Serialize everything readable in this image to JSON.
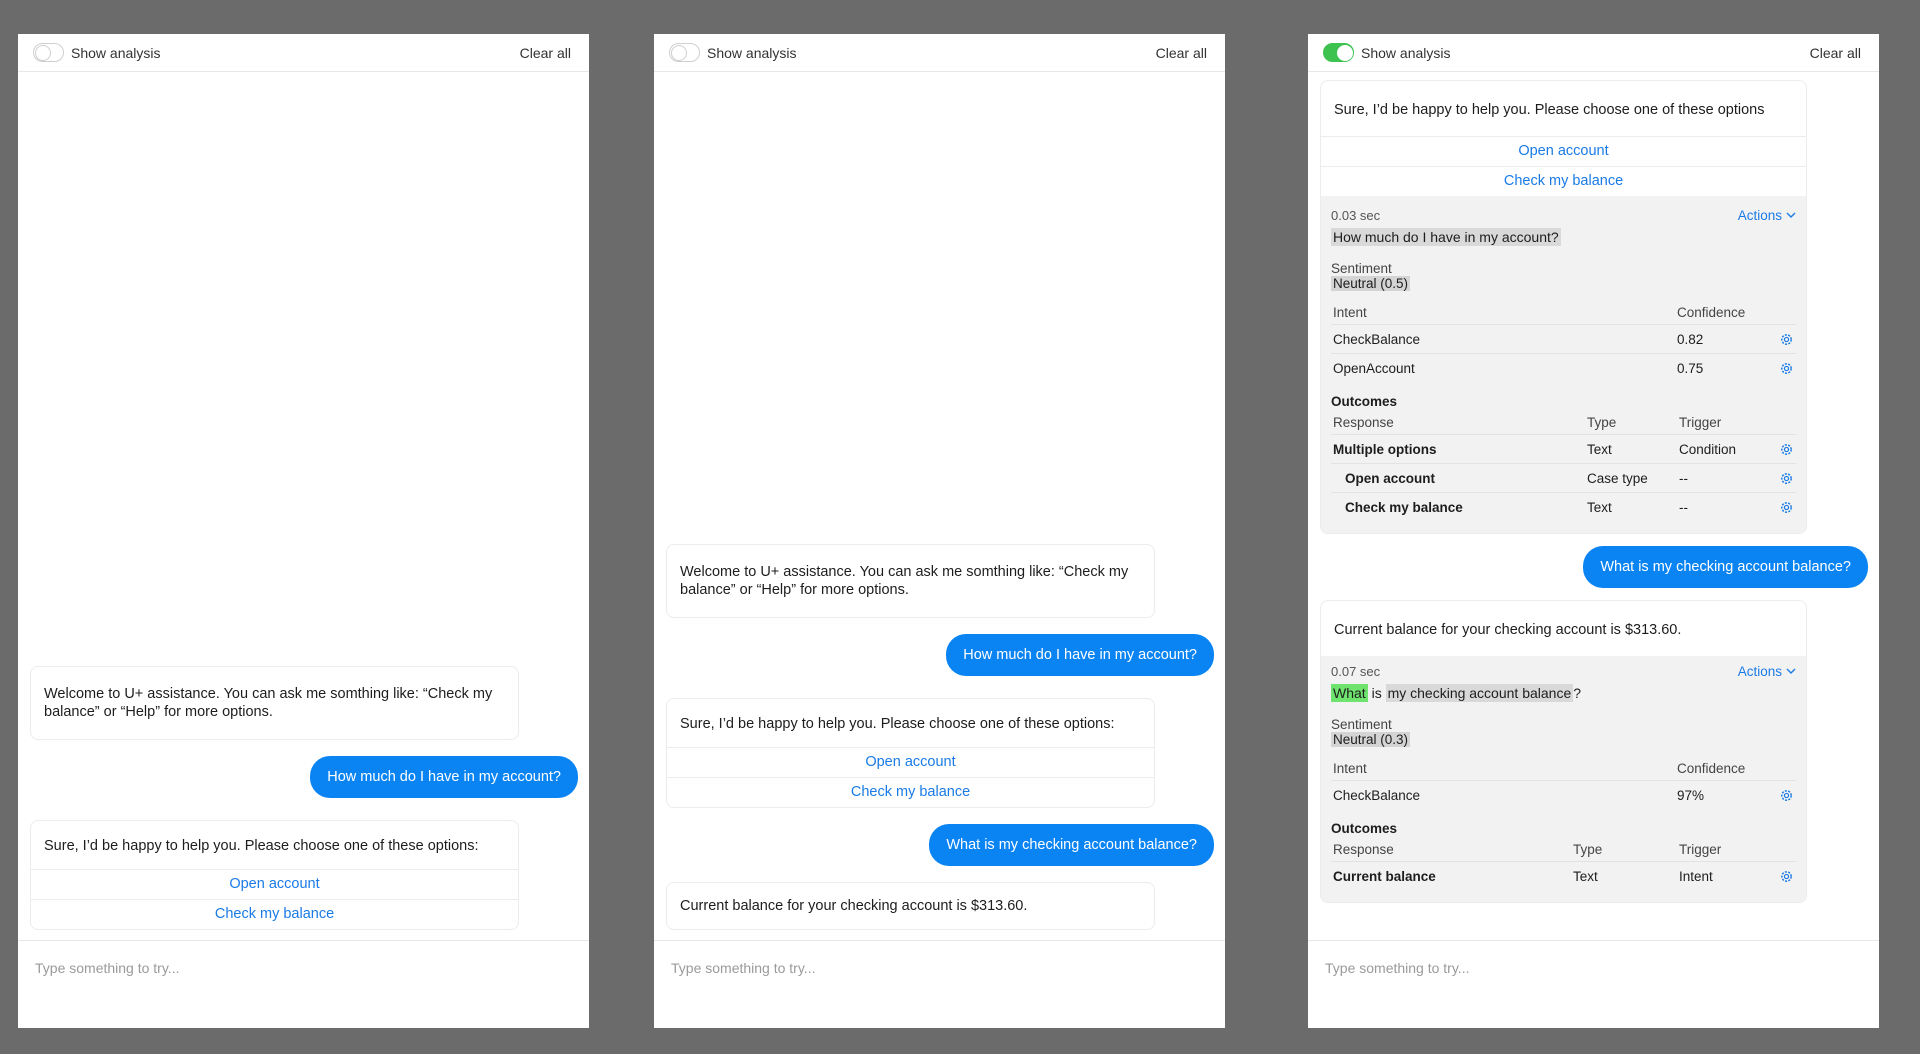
{
  "common": {
    "show_analysis_label": "Show analysis",
    "clear_all_label": "Clear all",
    "composer_placeholder": "Type something to try..."
  },
  "panel1": {
    "toggle_on": false,
    "welcome": "Welcome to U+ assistance. You can ask me somthing like: “Check my balance” or “Help” for more options.",
    "user1": "How much do I have in my account?",
    "bot2": "Sure, I’d be happy to help you. Please choose one of these options:",
    "option1": "Open account",
    "option2": "Check my balance"
  },
  "panel2": {
    "toggle_on": false,
    "welcome": "Welcome to U+ assistance. You can ask me somthing like: “Check my balance” or “Help” for more options.",
    "user1": "How much do I have in my account?",
    "bot2": "Sure, I’d be happy to help you. Please choose one of these options:",
    "option1": "Open account",
    "option2": "Check my balance",
    "user2": "What is my checking account balance?",
    "bot3": "Current balance for your checking account is $313.60."
  },
  "panel3": {
    "toggle_on": true,
    "toggle_color": "#3ec24f",
    "bot1": "Sure, I’d be happy to help you. Please choose one of these options",
    "option1": "Open account",
    "option2": "Check my balance",
    "analysis1": {
      "time": "0.03 sec",
      "actions_label": "Actions",
      "utterance": "How much do I have in my account?",
      "sentiment_label": "Sentiment",
      "sentiment_value": "Neutral (0.5)",
      "intent_header": "Intent",
      "confidence_header": "Confidence",
      "intents": [
        {
          "name": "CheckBalance",
          "confidence": "0.82"
        },
        {
          "name": "OpenAccount",
          "confidence": "0.75"
        }
      ],
      "outcomes_title": "Outcomes",
      "response_header": "Response",
      "type_header": "Type",
      "trigger_header": "Trigger",
      "outcomes": [
        {
          "response": "Multiple options",
          "type": "Text",
          "trigger": "Condition"
        },
        {
          "response": "Open account",
          "type": "Case type",
          "trigger": "--"
        },
        {
          "response": "Check my balance",
          "type": "Text",
          "trigger": "--"
        }
      ]
    },
    "user": "What is my checking account balance?",
    "bot2": "Current balance for your checking account is $313.60.",
    "analysis2": {
      "time": "0.07 sec",
      "actions_label": "Actions",
      "utterance_parts": [
        "What",
        " is ",
        "my checking account balance",
        "?"
      ],
      "sentiment_label": "Sentiment",
      "sentiment_value": "Neutral (0.3)",
      "intent_header": "Intent",
      "confidence_header": "Confidence",
      "intents": [
        {
          "name": "CheckBalance",
          "confidence": "97%"
        }
      ],
      "outcomes_title": "Outcomes",
      "response_header": "Response",
      "type_header": "Type",
      "trigger_header": "Trigger",
      "outcomes": [
        {
          "response": "Current balance",
          "type": "Text",
          "trigger": "Intent"
        }
      ]
    }
  },
  "colors": {
    "background": "#6b6b6b",
    "user_bubble": "#0b84f3",
    "link": "#1a7be6",
    "highlight_green": "#6ee36e",
    "highlight_gray": "#d9d9d9"
  }
}
